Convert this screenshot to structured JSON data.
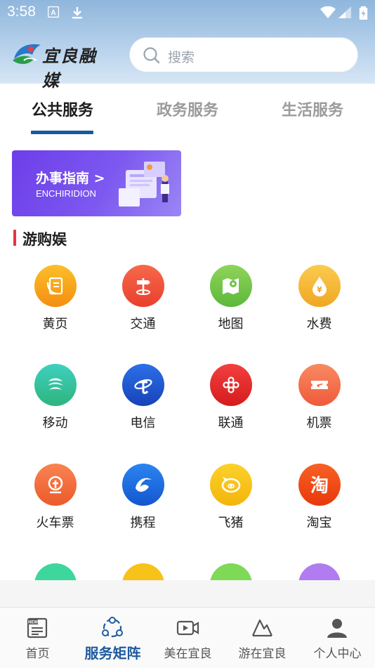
{
  "status_bar": {
    "time": "3:58"
  },
  "header": {
    "logo_text": "宜良融媒",
    "search_placeholder": "搜索"
  },
  "tabs": [
    {
      "label": "公共服务",
      "active": true
    },
    {
      "label": "政务服务",
      "active": false
    },
    {
      "label": "生活服务",
      "active": false
    }
  ],
  "banner": {
    "title": "办事指南 >",
    "subtitle": "ENCHIRIDION"
  },
  "section": {
    "title": "游购娱"
  },
  "services": [
    {
      "label": "黄页",
      "icon": "phone-book-icon",
      "color": "#f8a21a"
    },
    {
      "label": "交通",
      "icon": "signpost-icon",
      "color": "#f0533d"
    },
    {
      "label": "地图",
      "icon": "map-icon",
      "color": "#74c54b"
    },
    {
      "label": "水费",
      "icon": "water-drop-icon",
      "color": "#f5b93a"
    },
    {
      "label": "移动",
      "icon": "china-mobile-icon",
      "color": "#3dc6a0"
    },
    {
      "label": "电信",
      "icon": "china-telecom-icon",
      "color": "#1f5bd6"
    },
    {
      "label": "联通",
      "icon": "china-unicom-icon",
      "color": "#e8282a"
    },
    {
      "label": "机票",
      "icon": "air-ticket-icon",
      "color": "#f36d4f"
    },
    {
      "label": "火车票",
      "icon": "train-ticket-icon",
      "color": "#f56d3a"
    },
    {
      "label": "携程",
      "icon": "ctrip-dolphin-icon",
      "color": "#1f6fe0"
    },
    {
      "label": "飞猪",
      "icon": "fliggy-pig-icon",
      "color": "#f7c21a"
    },
    {
      "label": "淘宝",
      "icon": "taobao-icon",
      "color": "#f14b16"
    }
  ],
  "partial_row_colors": [
    "#3dd69c",
    "#f7c21a",
    "#7ed957",
    "#b07cf0"
  ],
  "bottom_nav": [
    {
      "label": "首页",
      "icon": "news-icon",
      "active": false
    },
    {
      "label": "服务矩阵",
      "icon": "service-matrix-icon",
      "active": true
    },
    {
      "label": "美在宜良",
      "icon": "video-icon",
      "active": false
    },
    {
      "label": "游在宜良",
      "icon": "mountain-icon",
      "active": false
    },
    {
      "label": "个人中心",
      "icon": "person-icon",
      "active": false
    }
  ],
  "colors": {
    "accent": "#1559a0",
    "section_marker": "#e8353f"
  }
}
